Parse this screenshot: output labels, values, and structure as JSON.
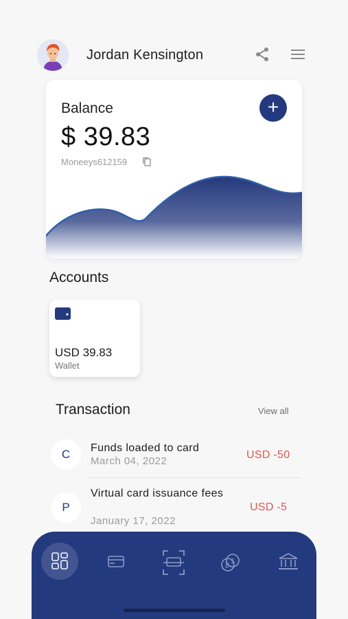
{
  "user": {
    "name": "Jordan Kensington"
  },
  "balance": {
    "label": "Balance",
    "amount": "$ 39.83",
    "account_id": "Moneeys612159"
  },
  "accounts": {
    "title": "Accounts",
    "items": [
      {
        "amount": "USD 39.83",
        "label": "Wallet"
      }
    ]
  },
  "transactions": {
    "title": "Transaction",
    "view_all": "View all",
    "items": [
      {
        "letter": "C",
        "name": "Funds loaded to card",
        "date": "March 04, 2022",
        "amount": "USD -50"
      },
      {
        "letter": "P",
        "name": "Virtual card issuance fees",
        "date": "January 17, 2022",
        "amount": "USD -5"
      }
    ]
  },
  "nav": {
    "items": [
      {
        "icon": "dashboard-icon",
        "active": true
      },
      {
        "icon": "cards-icon",
        "active": false
      },
      {
        "icon": "scan-icon",
        "active": false
      },
      {
        "icon": "crypto-coins-icon",
        "active": false
      },
      {
        "icon": "bank-icon",
        "active": false
      }
    ]
  },
  "colors": {
    "primary": "#243a7e",
    "negative": "#e5554d",
    "background": "#f7f7f8"
  }
}
